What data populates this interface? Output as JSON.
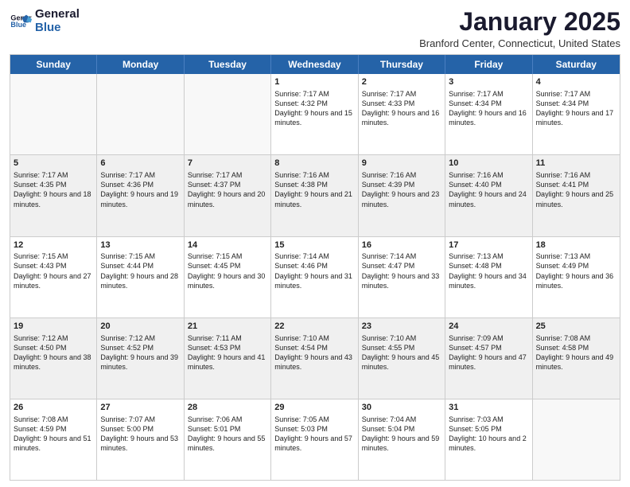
{
  "header": {
    "logo_general": "General",
    "logo_blue": "Blue",
    "month": "January 2025",
    "location": "Branford Center, Connecticut, United States"
  },
  "days": [
    "Sunday",
    "Monday",
    "Tuesday",
    "Wednesday",
    "Thursday",
    "Friday",
    "Saturday"
  ],
  "rows": [
    [
      {
        "day": "",
        "sunrise": "",
        "sunset": "",
        "daylight": "",
        "empty": true
      },
      {
        "day": "",
        "sunrise": "",
        "sunset": "",
        "daylight": "",
        "empty": true
      },
      {
        "day": "",
        "sunrise": "",
        "sunset": "",
        "daylight": "",
        "empty": true
      },
      {
        "day": "1",
        "sunrise": "Sunrise: 7:17 AM",
        "sunset": "Sunset: 4:32 PM",
        "daylight": "Daylight: 9 hours and 15 minutes."
      },
      {
        "day": "2",
        "sunrise": "Sunrise: 7:17 AM",
        "sunset": "Sunset: 4:33 PM",
        "daylight": "Daylight: 9 hours and 16 minutes."
      },
      {
        "day": "3",
        "sunrise": "Sunrise: 7:17 AM",
        "sunset": "Sunset: 4:34 PM",
        "daylight": "Daylight: 9 hours and 16 minutes."
      },
      {
        "day": "4",
        "sunrise": "Sunrise: 7:17 AM",
        "sunset": "Sunset: 4:34 PM",
        "daylight": "Daylight: 9 hours and 17 minutes."
      }
    ],
    [
      {
        "day": "5",
        "sunrise": "Sunrise: 7:17 AM",
        "sunset": "Sunset: 4:35 PM",
        "daylight": "Daylight: 9 hours and 18 minutes."
      },
      {
        "day": "6",
        "sunrise": "Sunrise: 7:17 AM",
        "sunset": "Sunset: 4:36 PM",
        "daylight": "Daylight: 9 hours and 19 minutes."
      },
      {
        "day": "7",
        "sunrise": "Sunrise: 7:17 AM",
        "sunset": "Sunset: 4:37 PM",
        "daylight": "Daylight: 9 hours and 20 minutes."
      },
      {
        "day": "8",
        "sunrise": "Sunrise: 7:16 AM",
        "sunset": "Sunset: 4:38 PM",
        "daylight": "Daylight: 9 hours and 21 minutes."
      },
      {
        "day": "9",
        "sunrise": "Sunrise: 7:16 AM",
        "sunset": "Sunset: 4:39 PM",
        "daylight": "Daylight: 9 hours and 23 minutes."
      },
      {
        "day": "10",
        "sunrise": "Sunrise: 7:16 AM",
        "sunset": "Sunset: 4:40 PM",
        "daylight": "Daylight: 9 hours and 24 minutes."
      },
      {
        "day": "11",
        "sunrise": "Sunrise: 7:16 AM",
        "sunset": "Sunset: 4:41 PM",
        "daylight": "Daylight: 9 hours and 25 minutes."
      }
    ],
    [
      {
        "day": "12",
        "sunrise": "Sunrise: 7:15 AM",
        "sunset": "Sunset: 4:43 PM",
        "daylight": "Daylight: 9 hours and 27 minutes."
      },
      {
        "day": "13",
        "sunrise": "Sunrise: 7:15 AM",
        "sunset": "Sunset: 4:44 PM",
        "daylight": "Daylight: 9 hours and 28 minutes."
      },
      {
        "day": "14",
        "sunrise": "Sunrise: 7:15 AM",
        "sunset": "Sunset: 4:45 PM",
        "daylight": "Daylight: 9 hours and 30 minutes."
      },
      {
        "day": "15",
        "sunrise": "Sunrise: 7:14 AM",
        "sunset": "Sunset: 4:46 PM",
        "daylight": "Daylight: 9 hours and 31 minutes."
      },
      {
        "day": "16",
        "sunrise": "Sunrise: 7:14 AM",
        "sunset": "Sunset: 4:47 PM",
        "daylight": "Daylight: 9 hours and 33 minutes."
      },
      {
        "day": "17",
        "sunrise": "Sunrise: 7:13 AM",
        "sunset": "Sunset: 4:48 PM",
        "daylight": "Daylight: 9 hours and 34 minutes."
      },
      {
        "day": "18",
        "sunrise": "Sunrise: 7:13 AM",
        "sunset": "Sunset: 4:49 PM",
        "daylight": "Daylight: 9 hours and 36 minutes."
      }
    ],
    [
      {
        "day": "19",
        "sunrise": "Sunrise: 7:12 AM",
        "sunset": "Sunset: 4:50 PM",
        "daylight": "Daylight: 9 hours and 38 minutes."
      },
      {
        "day": "20",
        "sunrise": "Sunrise: 7:12 AM",
        "sunset": "Sunset: 4:52 PM",
        "daylight": "Daylight: 9 hours and 39 minutes."
      },
      {
        "day": "21",
        "sunrise": "Sunrise: 7:11 AM",
        "sunset": "Sunset: 4:53 PM",
        "daylight": "Daylight: 9 hours and 41 minutes."
      },
      {
        "day": "22",
        "sunrise": "Sunrise: 7:10 AM",
        "sunset": "Sunset: 4:54 PM",
        "daylight": "Daylight: 9 hours and 43 minutes."
      },
      {
        "day": "23",
        "sunrise": "Sunrise: 7:10 AM",
        "sunset": "Sunset: 4:55 PM",
        "daylight": "Daylight: 9 hours and 45 minutes."
      },
      {
        "day": "24",
        "sunrise": "Sunrise: 7:09 AM",
        "sunset": "Sunset: 4:57 PM",
        "daylight": "Daylight: 9 hours and 47 minutes."
      },
      {
        "day": "25",
        "sunrise": "Sunrise: 7:08 AM",
        "sunset": "Sunset: 4:58 PM",
        "daylight": "Daylight: 9 hours and 49 minutes."
      }
    ],
    [
      {
        "day": "26",
        "sunrise": "Sunrise: 7:08 AM",
        "sunset": "Sunset: 4:59 PM",
        "daylight": "Daylight: 9 hours and 51 minutes."
      },
      {
        "day": "27",
        "sunrise": "Sunrise: 7:07 AM",
        "sunset": "Sunset: 5:00 PM",
        "daylight": "Daylight: 9 hours and 53 minutes."
      },
      {
        "day": "28",
        "sunrise": "Sunrise: 7:06 AM",
        "sunset": "Sunset: 5:01 PM",
        "daylight": "Daylight: 9 hours and 55 minutes."
      },
      {
        "day": "29",
        "sunrise": "Sunrise: 7:05 AM",
        "sunset": "Sunset: 5:03 PM",
        "daylight": "Daylight: 9 hours and 57 minutes."
      },
      {
        "day": "30",
        "sunrise": "Sunrise: 7:04 AM",
        "sunset": "Sunset: 5:04 PM",
        "daylight": "Daylight: 9 hours and 59 minutes."
      },
      {
        "day": "31",
        "sunrise": "Sunrise: 7:03 AM",
        "sunset": "Sunset: 5:05 PM",
        "daylight": "Daylight: 10 hours and 2 minutes."
      },
      {
        "day": "",
        "sunrise": "",
        "sunset": "",
        "daylight": "",
        "empty": true
      }
    ]
  ]
}
